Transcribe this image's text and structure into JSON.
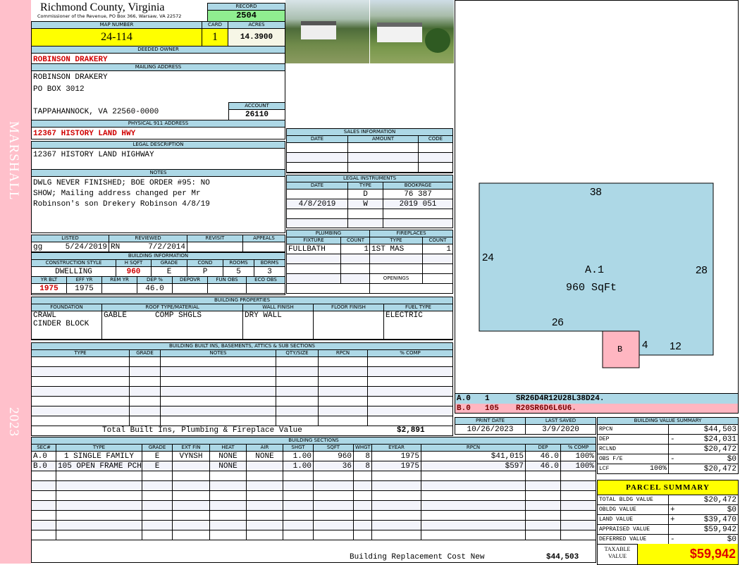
{
  "sidebar": {
    "district": "MARSHALL",
    "year": "2023"
  },
  "header": {
    "title": "Richmond County, Virginia",
    "subtitle": "Commissioner of the Revenue, PO Box 366, Warsaw, VA 22572",
    "record_label": "RECORD",
    "record": "2504"
  },
  "parcel": {
    "map_label": "MAP NUMBER",
    "map": "24-114",
    "card_label": "CARD",
    "card": "1",
    "acres_label": "ACRES",
    "acres": "14.3900"
  },
  "owner": {
    "label": "DEEDED OWNER",
    "name": "ROBINSON DRAKERY"
  },
  "mailing": {
    "label": "MAILING ADDRESS",
    "line1": "ROBINSON DRAKERY",
    "line2": "PO BOX 3012",
    "line3": "TAPPAHANNOCK, VA 22560-0000",
    "account_label": "ACCOUNT",
    "account": "26110"
  },
  "physical": {
    "label": "PHYSICAL 911 ADDRESS",
    "value": "12367 HISTORY LAND HWY"
  },
  "legal": {
    "label": "LEGAL DESCRIPTION",
    "value": "12367 HISTORY LAND HIGHWAY"
  },
  "notes": {
    "label": "NOTES",
    "line1": "DWLG NEVER FINISHED; BOE ORDER #95: NO",
    "line2": "SHOW; Mailing address changed per Mr",
    "line3": "Robinson's son Drekery Robinson 4/8/19"
  },
  "listed": {
    "listed_label": "LISTED",
    "reviewed_label": "REVIEWED",
    "revisit_label": "REVISIT",
    "appeals_label": "APPEALS",
    "listed_by": "gg",
    "listed_date": "5/24/2019",
    "reviewed_by": "RN",
    "reviewed_date": "7/2/2014"
  },
  "building_info": {
    "title": "BUILDING INFORMATION",
    "headers1": [
      "CONSTRUCTION STYLE",
      "H SQFT",
      "GRADE",
      "COND",
      "ROOMS",
      "BDRMS"
    ],
    "values1": [
      "DWELLING",
      "960",
      "E",
      "P",
      "5",
      "3"
    ],
    "headers2": [
      "YR BLT",
      "EFF YR",
      "REM YR",
      "DEP %",
      "DEPOVR",
      "FUN OBS",
      "ECO OBS"
    ],
    "values2": [
      "1975",
      "1975",
      "",
      "46.0",
      "",
      "",
      ""
    ]
  },
  "sales": {
    "title": "SALES INFORMATION",
    "headers": [
      "DATE",
      "AMOUNT",
      "CODE"
    ],
    "rows": [
      [
        "",
        "",
        ""
      ],
      [
        "",
        "",
        ""
      ],
      [
        "",
        "",
        ""
      ]
    ]
  },
  "legal_instruments": {
    "title": "LEGAL INSTRUMENTS",
    "headers": [
      "DATE",
      "TYPE",
      "BOOKPAGE"
    ],
    "rows": [
      [
        "",
        "D",
        "76 387"
      ],
      [
        "4/8/2019",
        "W",
        "2019 051"
      ],
      [
        "",
        "",
        ""
      ],
      [
        "",
        "",
        ""
      ]
    ]
  },
  "plumbing": {
    "title": "PLUMBING",
    "headers": [
      "FIXTURE",
      "COUNT"
    ],
    "rows": [
      [
        "FULLBATH",
        "1"
      ],
      [
        "",
        ""
      ],
      [
        "",
        ""
      ],
      [
        "",
        ""
      ]
    ]
  },
  "fireplaces": {
    "title": "FIREPLACES",
    "headers": [
      "TYPE",
      "COUNT"
    ],
    "rows": [
      [
        "1ST MAS",
        "1"
      ],
      [
        "",
        ""
      ],
      [
        "",
        ""
      ]
    ],
    "openings_label": "OPENINGS"
  },
  "properties": {
    "title": "BUILDING PROPERTIES",
    "headers": [
      "FOUNDATION",
      "ROOF TYPE/MATERIAL",
      "WALL FINISH",
      "FLOOR FINISH",
      "FUEL TYPE"
    ],
    "foundation1": "CRAWL",
    "foundation2": "CINDER BLOCK",
    "roof_type": "GABLE",
    "roof_material": "COMP SHGLS",
    "wall": "DRY WALL",
    "fuel": "ELECTRIC"
  },
  "builtins": {
    "title": "BUILDING BUILT INS, BASEMENTS, ATTICS & SUB SECTIONS",
    "headers": [
      "TYPE",
      "GRADE",
      "NOTES",
      "QTY/SIZE",
      "RPCN",
      "% COMP"
    ],
    "rows": [
      [
        "",
        "",
        "",
        "",
        "",
        ""
      ],
      [
        "",
        "",
        "",
        "",
        "",
        ""
      ],
      [
        "",
        "",
        "",
        "",
        "",
        ""
      ],
      [
        "",
        "",
        "",
        "",
        "",
        ""
      ],
      [
        "",
        "",
        "",
        "",
        "",
        ""
      ],
      [
        "",
        "",
        "",
        "",
        "",
        ""
      ],
      [
        "",
        "",
        "",
        "",
        "",
        ""
      ]
    ],
    "total_label": "Total Built Ins, Plumbing & Fireplace Value",
    "total": "$2,891"
  },
  "sections": {
    "title": "BUILDING SECTIONS",
    "headers": [
      "SEC#",
      "TYPE",
      "GRADE",
      "EXT FIN",
      "HEAT",
      "AIR",
      "SHGT",
      "SQFT",
      "WHGT",
      "EYEAR",
      "RPCN",
      "DEP",
      "% COMP"
    ],
    "rows": [
      [
        "A.0",
        "1 SINGLE FAMILY",
        "E",
        "VYNSH",
        "NONE",
        "NONE",
        "1.00",
        "960",
        "8",
        "1975",
        "$41,015",
        "46.0",
        "100%"
      ],
      [
        "B.0",
        "105 OPEN FRAME PCH",
        "E",
        "",
        "NONE",
        "",
        "1.00",
        "36",
        "8",
        "1975",
        "$597",
        "46.0",
        "100%"
      ],
      [
        "",
        "",
        "",
        "",
        "",
        "",
        "",
        "",
        "",
        "",
        "",
        "",
        ""
      ],
      [
        "",
        "",
        "",
        "",
        "",
        "",
        "",
        "",
        "",
        "",
        "",
        "",
        ""
      ],
      [
        "",
        "",
        "",
        "",
        "",
        "",
        "",
        "",
        "",
        "",
        "",
        "",
        ""
      ],
      [
        "",
        "",
        "",
        "",
        "",
        "",
        "",
        "",
        "",
        "",
        "",
        "",
        ""
      ],
      [
        "",
        "",
        "",
        "",
        "",
        "",
        "",
        "",
        "",
        "",
        "",
        "",
        ""
      ],
      [
        "",
        "",
        "",
        "",
        "",
        "",
        "",
        "",
        "",
        "",
        "",
        "",
        ""
      ],
      [
        "",
        "",
        "",
        "",
        "",
        "",
        "",
        "",
        "",
        "",
        "",
        "",
        ""
      ]
    ],
    "total_label": "Building Replacement Cost New",
    "total": "$44,503"
  },
  "sketch": {
    "main_label": "A.1",
    "main_area": "960 SqFt",
    "porch_label": "B",
    "dim_top": "38",
    "dim_left": "24",
    "dim_right": "28",
    "dim_bottom": "26",
    "dim_step": "4",
    "dim_step_width": "12"
  },
  "sketch_list": [
    [
      "A.0",
      "1",
      "SR26D4R12U28L38D24."
    ],
    [
      "B.0",
      "105",
      "R20SR6D6L6U6."
    ]
  ],
  "dates": {
    "print_label": "PRINT DATE",
    "print": "10/26/2023",
    "saved_label": "LAST SAVED",
    "saved": "3/9/2020"
  },
  "value_summary": {
    "title": "BUILDING VALUE SUMMARY",
    "rows": [
      [
        "RPCN",
        "",
        "",
        "$44,503"
      ],
      [
        "DEP",
        "",
        "-",
        "$24,031"
      ],
      [
        "RCLND",
        "",
        "",
        "$20,472"
      ],
      [
        "OBS F/E",
        "",
        "-",
        "$0"
      ],
      [
        "LCF",
        "100%",
        "",
        "$20,472"
      ]
    ]
  },
  "parcel_summary": {
    "title": "PARCEL SUMMARY",
    "rows": [
      [
        "TOTAL BLDG VALUE",
        "",
        "$20,472"
      ],
      [
        "OBLDG VALUE",
        "+",
        "$0"
      ],
      [
        "LAND VALUE",
        "+",
        "$39,470"
      ],
      [
        "APPRAISED VALUE",
        "",
        "$59,942"
      ],
      [
        "DEFERRED VALUE",
        "-",
        "$0"
      ]
    ],
    "taxable_label": "TAXABLE VALUE",
    "taxable": "$59,942"
  },
  "colors": {
    "header": "#add8e6",
    "highlight": "#ffff00",
    "record": "#90ee90",
    "sidebar": "#ffc0cb",
    "sketch_main": "#add8e6",
    "sketch_porch": "#ffb6c1",
    "emphasis": "#d00000"
  }
}
